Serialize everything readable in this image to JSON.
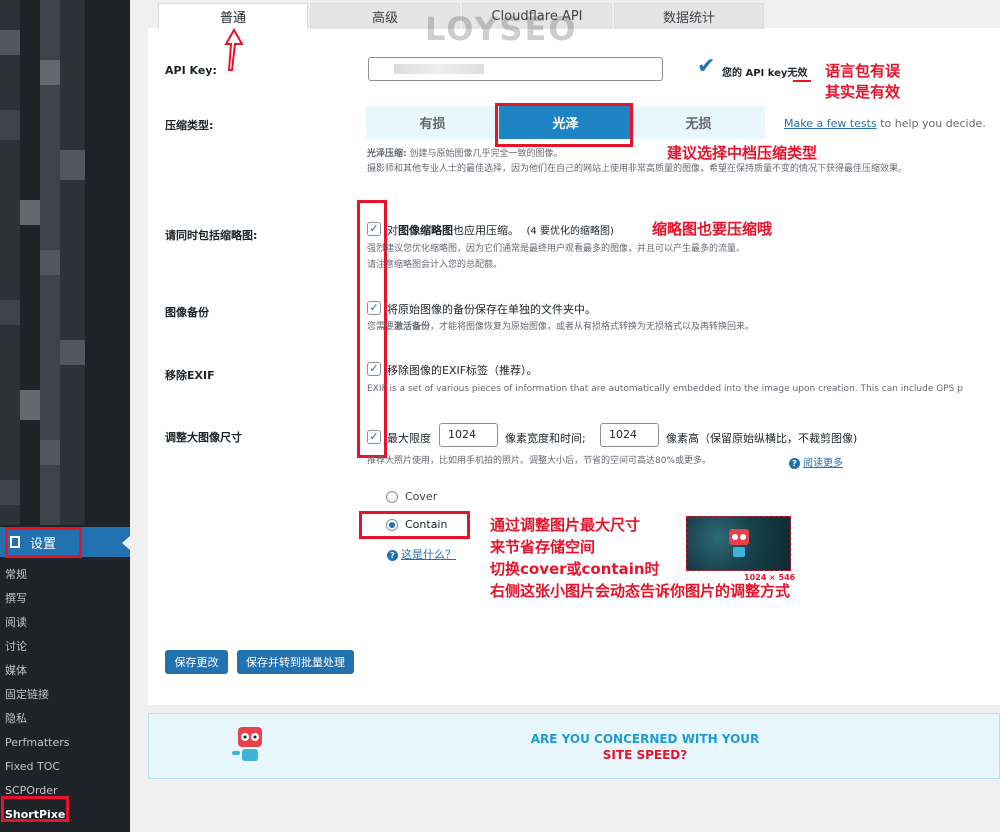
{
  "sidebar": {
    "settings_label": "设置",
    "sub_items": [
      "常规",
      "撰写",
      "阅读",
      "讨论",
      "媒体",
      "固定链接",
      "隐私",
      "Perfmatters",
      "Fixed TOC",
      "SCPOrder",
      "ShortPixel"
    ],
    "current": "ShortPixel"
  },
  "tabs": [
    "普通",
    "高级",
    "Cloudflare API",
    "数据统计"
  ],
  "watermark": "LOYSEO",
  "api_key": {
    "label": "API Key:",
    "status": "您的 API key无效"
  },
  "compression": {
    "label": "压缩类型:",
    "options": [
      "有损",
      "光泽",
      "无损"
    ],
    "selected": "光泽",
    "test_link": "Make a few tests",
    "test_suffix": " to help you decide.",
    "desc_title": "光泽压缩:",
    "desc_line1": " 创建与原始图像几乎完全一致的图像。",
    "desc_line2": "摄影师和其他专业人士的最佳选择，因为他们在自己的网站上使用非常高质量的图像，希望在保持质量不变的情况下获得最佳压缩效果。"
  },
  "thumbnails": {
    "label": "请同时包括缩略图:",
    "check_prefix": "对",
    "check_bold": "图像缩略图",
    "check_suffix": "也应用压缩。",
    "count": "(4 要优化的缩略图)",
    "desc1": "强烈建议您优化缩略图，因为它们通常是最终用户观看最多的图像，并且可以产生最多的流量。",
    "desc2": "请注意缩略图会计入您的总配额。"
  },
  "backup": {
    "label": "图像备份",
    "text": "将原始图像的备份保存在单独的文件夹中。",
    "desc_prefix": "您需要",
    "desc_bold": "激活备份",
    "desc_suffix": "，才能将图像恢复为原始图像，或者从有损格式转换为无损格式以及再转换回来。"
  },
  "exif": {
    "label": "移除EXIF",
    "text": "移除图像的EXIF标签（推荐）。",
    "desc": "EXIF is a set of various pieces of information that are automatically embedded into the image upon creation. This can include GPS p"
  },
  "resize": {
    "label": "调整大图像尺寸",
    "max_label": "最大限度",
    "width": "1024",
    "width_suffix": "像素宽度和时间;",
    "height": "1024",
    "height_suffix": "像素高（保留原始纵横比，不裁剪图像)",
    "desc": "推荐大照片使用，比如用手机拍的照片。调整大小后，节省的空间可高达80%或更多。",
    "read_more": "阅读更多",
    "options": [
      "Cover",
      "Contain"
    ],
    "selected": "Contain",
    "what_is": "这是什么？",
    "preview_size": "1024 × 546"
  },
  "buttons": {
    "save": "保存更改",
    "save_bulk": "保存并转到批量处理"
  },
  "banner": {
    "line1": "ARE YOU CONCERNED WITH YOUR",
    "line2": "SITE SPEED?"
  },
  "annotations": {
    "lang_error_1": "语言包有误",
    "lang_error_2": "其实是有效",
    "suggest_glossy": "建议选择中档压缩类型",
    "thumb_note": "缩略图也要压缩哦",
    "resize_1": "通过调整图片最大尺寸",
    "resize_2": "来节省存储空间",
    "resize_3": "切换cover或contain时",
    "resize_4": "右侧这张小图片会动态告诉你图片的调整方式"
  },
  "colors": {
    "accent": "#2271b1",
    "annotation_red": "#e8132a",
    "sidebar": "#1d2327"
  }
}
